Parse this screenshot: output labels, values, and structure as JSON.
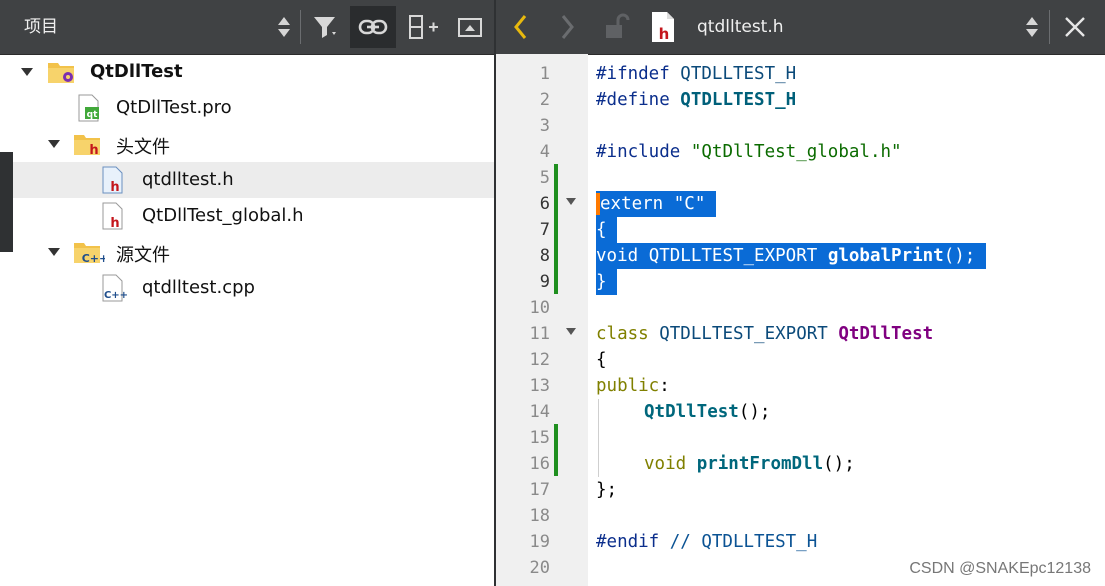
{
  "project_pane": {
    "combo_label": "项目",
    "toolbar_icons": [
      "filter-icon",
      "link-icon",
      "split-add-icon",
      "expand-icon"
    ],
    "tree": [
      {
        "label": "QtDllTest",
        "icon": "project-folder-icon",
        "level": 0,
        "expanded": true,
        "bold": true
      },
      {
        "label": "QtDllTest.pro",
        "icon": "qt-pro-file-icon",
        "level": 1
      },
      {
        "label": "头文件",
        "icon": "header-folder-icon",
        "level": 1,
        "expanded": true
      },
      {
        "label": "qtdlltest.h",
        "icon": "header-file-icon",
        "level": 2,
        "selected": true
      },
      {
        "label": "QtDllTest_global.h",
        "icon": "header-file-icon",
        "level": 2
      },
      {
        "label": "源文件",
        "icon": "source-folder-icon",
        "level": 1,
        "expanded": true
      },
      {
        "label": "qtdlltest.cpp",
        "icon": "cpp-file-icon",
        "level": 2
      }
    ]
  },
  "editor": {
    "file_name": "qtdlltest.h",
    "toolbar_icons": [
      "back-icon",
      "forward-icon",
      "unlock-icon",
      "header-file-icon",
      "close-icon"
    ],
    "line_numbers": [
      "1",
      "2",
      "3",
      "4",
      "5",
      "6",
      "7",
      "8",
      "9",
      "10",
      "11",
      "12",
      "13",
      "14",
      "15",
      "16",
      "17",
      "18",
      "19",
      "20"
    ],
    "lines": {
      "l1_pp": "#ifndef",
      "l1_mac": " QTDLLTEST_H",
      "l2_pp": "#define",
      "l2_mac": " QTDLLTEST_H",
      "l4_pp": "#include",
      "l4_str": " \"QtDllTest_global.h\"",
      "l6_kw": "extern",
      "l6_str": " \"C\"",
      "l7": "{",
      "l8_kw": "void",
      "l8_mac": " QTDLLTEST_EXPORT ",
      "l8_fn": "globalPrint",
      "l8_rest": "();",
      "l9": "}",
      "l11_kw": "class",
      "l11_mac": " QTDLLTEST_EXPORT ",
      "l11_cls": "QtDllTest",
      "l12": "{",
      "l13_kw": "public",
      "l13_rest": ":",
      "l14_fn": "QtDllTest",
      "l14_rest": "();",
      "l16_kw": "void",
      "l16_fn": " printFromDll",
      "l16_rest": "();",
      "l17": "};",
      "l19_pp": "#endif",
      "l19_cm": " // QTDLLTEST_H"
    }
  },
  "watermark": "CSDN @SNAKEpc12138",
  "colors": {
    "toolbar_bg": "#404244",
    "selection": "#0a6bd6",
    "change_marker": "#1f8f1f",
    "back_arrow": "#e8b90e"
  }
}
